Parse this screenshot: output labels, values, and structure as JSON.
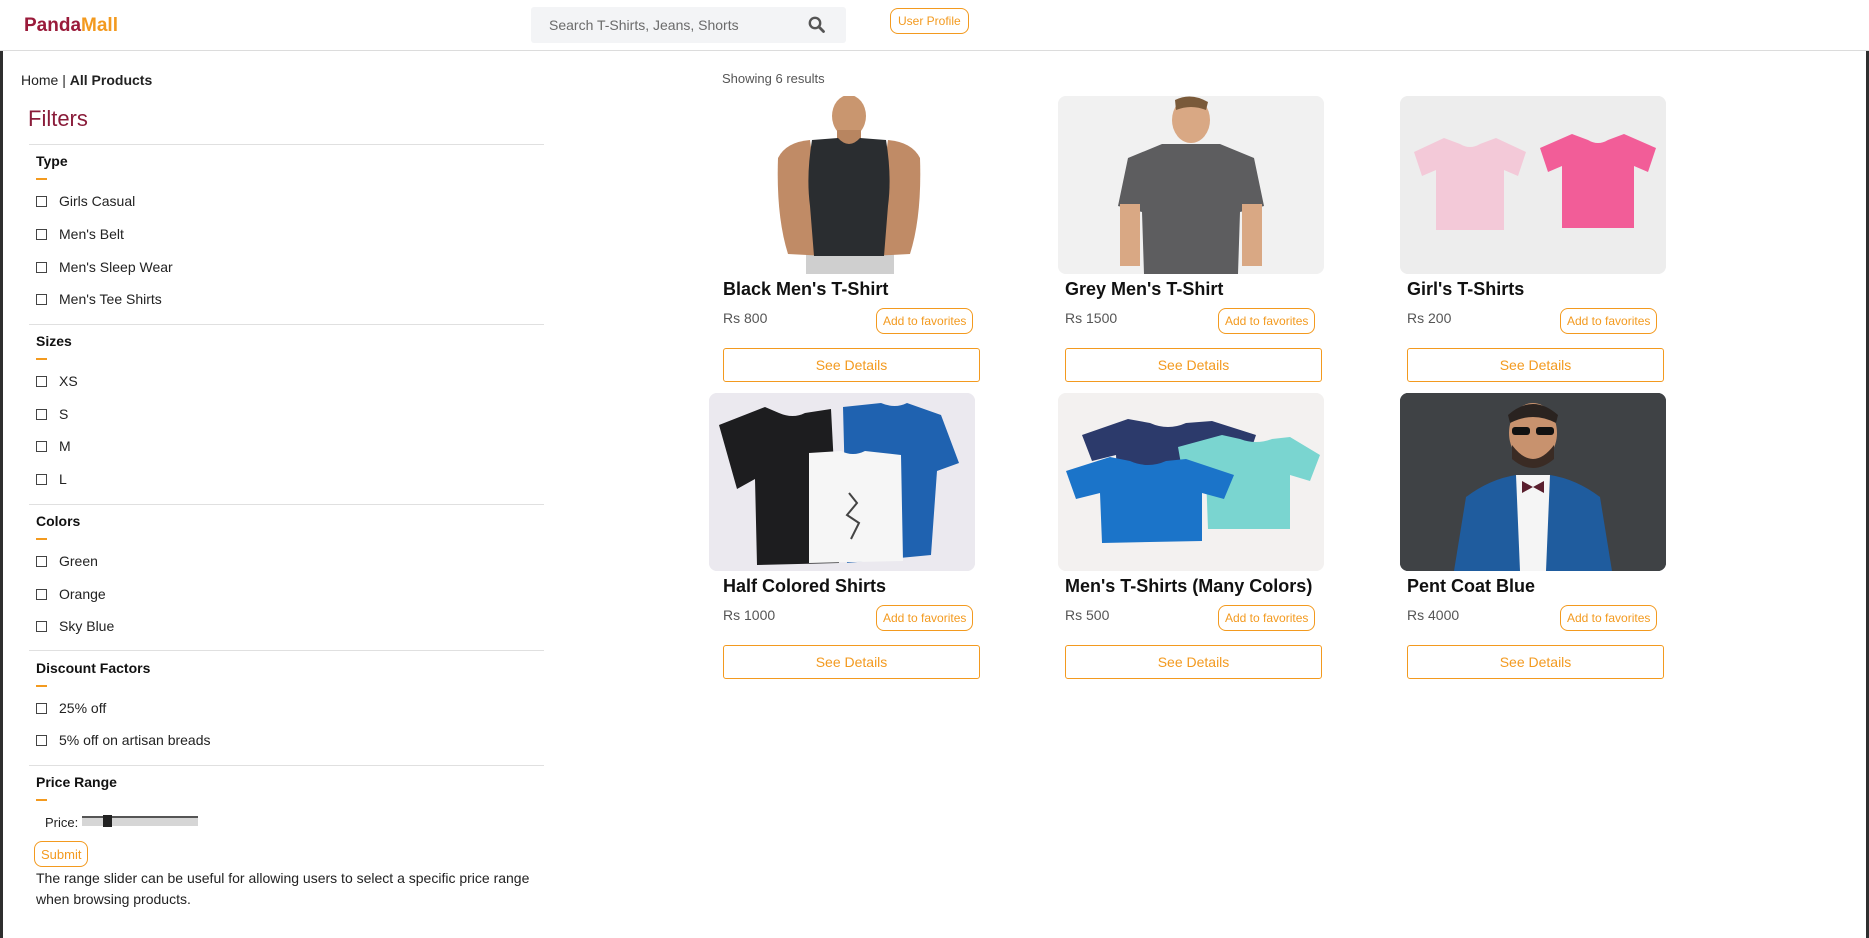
{
  "header": {
    "logo_part1": "Panda",
    "logo_part2": "Mall",
    "search_placeholder": "Search T-Shirts, Jeans, Shorts",
    "profile_label": "User Profile"
  },
  "breadcrumb": {
    "home": "Home",
    "separator": " | ",
    "current": "All Products"
  },
  "filters": {
    "title": "Filters",
    "type": {
      "title": "Type",
      "options": [
        "Girls Casual",
        "Men's Belt",
        "Men's Sleep Wear",
        "Men's Tee Shirts"
      ]
    },
    "sizes": {
      "title": "Sizes",
      "options": [
        "XS",
        "S",
        "M",
        "L"
      ]
    },
    "colors": {
      "title": "Colors",
      "options": [
        "Green",
        "Orange",
        "Sky Blue"
      ]
    },
    "discounts": {
      "title": "Discount Factors",
      "options": [
        "25% off",
        "5% off on artisan breads"
      ]
    },
    "price": {
      "title": "Price Range",
      "label": "Price:",
      "slider_fraction": 0.2,
      "submit_label": "Submit",
      "note": "The range slider can be useful for allowing users to select a specific price range when browsing products."
    }
  },
  "results": {
    "count_text": "Showing 6 results",
    "fav_label": "Add to favorites",
    "details_label": "See Details",
    "products": [
      {
        "name": "Black Men's T-Shirt",
        "price": "Rs 800"
      },
      {
        "name": "Grey Men's T-Shirt",
        "price": "Rs 1500"
      },
      {
        "name": "Girl's T-Shirts",
        "price": "Rs 200"
      },
      {
        "name": "Half Colored Shirts",
        "price": "Rs 1000"
      },
      {
        "name": "Men's T-Shirts (Many Colors)",
        "price": "Rs 500"
      },
      {
        "name": "Pent Coat Blue",
        "price": "Rs 4000"
      }
    ]
  },
  "colors": {
    "accent": "#f39a1f",
    "brand": "#9a1a3a",
    "filters_title": "#8a1c3a"
  }
}
